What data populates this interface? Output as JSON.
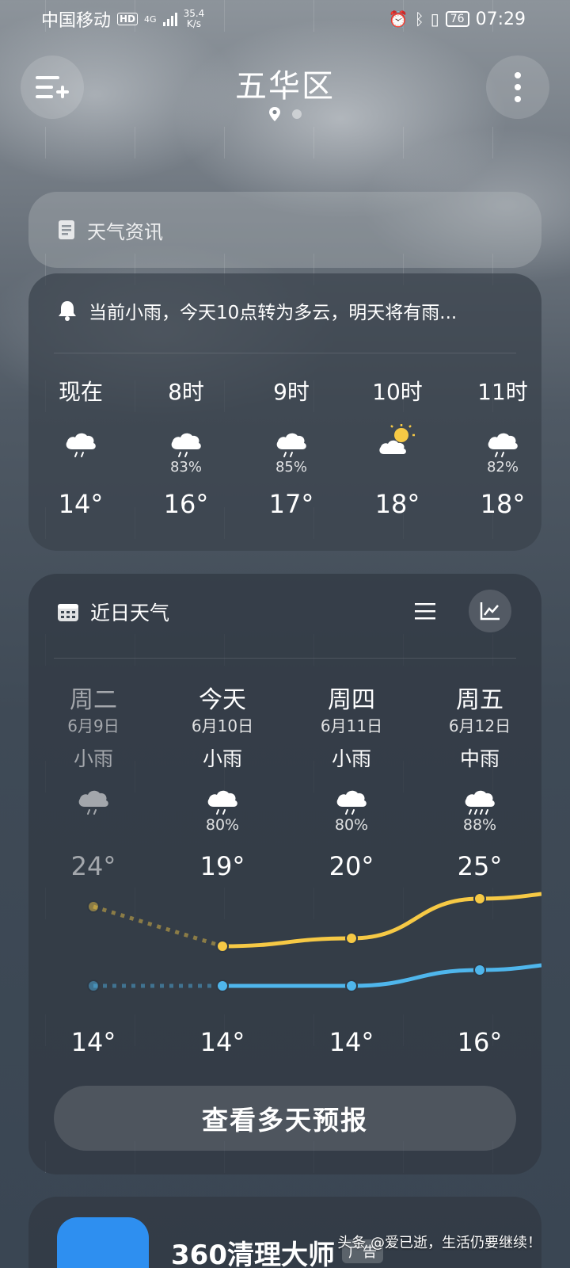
{
  "status_bar": {
    "carrier": "中国移动",
    "hd_badge": "HD",
    "network_type": "4G",
    "net_speed_value": "35.4",
    "net_speed_unit": "K/s",
    "battery_level": "76",
    "time": "07:29"
  },
  "header": {
    "city": "五华区",
    "page_count": 2,
    "active_page": 1
  },
  "news_card": {
    "label": "天气资讯"
  },
  "hourly": {
    "alert_text": "当前小雨，今天10点转为多云，明天将有雨...",
    "items": [
      {
        "label": "现在",
        "icon": "light-rain-icon",
        "prob": "",
        "temp": "14°"
      },
      {
        "label": "8时",
        "icon": "rain-cloud-icon",
        "prob": "83%",
        "temp": "16°"
      },
      {
        "label": "9时",
        "icon": "rain-cloud-icon",
        "prob": "85%",
        "temp": "17°"
      },
      {
        "label": "10时",
        "icon": "partly-cloudy-icon",
        "prob": "",
        "temp": "18°"
      },
      {
        "label": "11时",
        "icon": "rain-cloud-icon",
        "prob": "82%",
        "temp": "18°"
      }
    ]
  },
  "daily": {
    "title": "近日天气",
    "view_mode": "chart",
    "items": [
      {
        "day": "周二",
        "date": "6月9日",
        "cond": "小雨",
        "icon": "light-rain-icon",
        "prob": "",
        "high": "24°",
        "low": "14°",
        "past": true
      },
      {
        "day": "今天",
        "date": "6月10日",
        "cond": "小雨",
        "icon": "light-rain-icon",
        "prob": "80%",
        "high": "19°",
        "low": "14°",
        "past": false
      },
      {
        "day": "周四",
        "date": "6月11日",
        "cond": "小雨",
        "icon": "light-rain-icon",
        "prob": "80%",
        "high": "20°",
        "low": "14°",
        "past": false
      },
      {
        "day": "周五",
        "date": "6月12日",
        "cond": "中雨",
        "icon": "moderate-rain-icon",
        "prob": "88%",
        "high": "25°",
        "low": "16°",
        "past": false
      }
    ],
    "chart_data": {
      "type": "line",
      "categories": [
        "周二",
        "今天",
        "周四",
        "周五"
      ],
      "series": [
        {
          "values": [
            24,
            19,
            20,
            25
          ],
          "color": "#f6c945"
        },
        {
          "values": [
            14,
            14,
            14,
            16
          ],
          "color": "#4fb6ec"
        }
      ]
    },
    "more_button": "查看多天预报"
  },
  "ad": {
    "title": "360清理大师",
    "tag": "广告"
  },
  "watermark": "头条 @爱已逝，生活仍要继续！",
  "colors": {
    "high_line": "#f6c945",
    "low_line": "#4fb6ec",
    "ad_icon_bg": "#2e8ff0"
  }
}
